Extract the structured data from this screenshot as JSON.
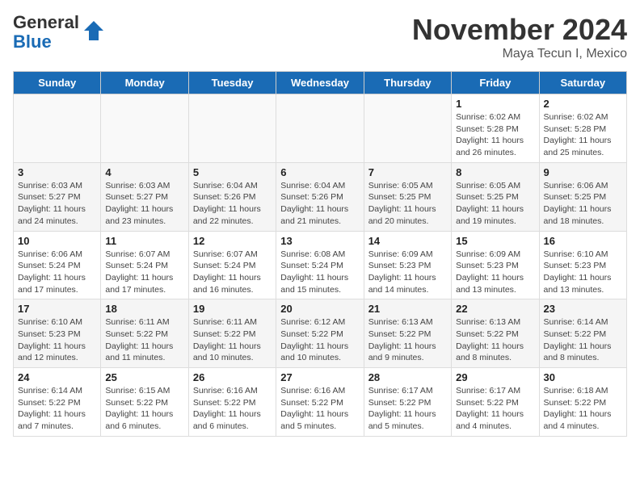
{
  "header": {
    "logo_general": "General",
    "logo_blue": "Blue",
    "month_title": "November 2024",
    "subtitle": "Maya Tecun I, Mexico"
  },
  "days_of_week": [
    "Sunday",
    "Monday",
    "Tuesday",
    "Wednesday",
    "Thursday",
    "Friday",
    "Saturday"
  ],
  "weeks": [
    [
      {
        "day": "",
        "info": ""
      },
      {
        "day": "",
        "info": ""
      },
      {
        "day": "",
        "info": ""
      },
      {
        "day": "",
        "info": ""
      },
      {
        "day": "",
        "info": ""
      },
      {
        "day": "1",
        "info": "Sunrise: 6:02 AM\nSunset: 5:28 PM\nDaylight: 11 hours and 26 minutes."
      },
      {
        "day": "2",
        "info": "Sunrise: 6:02 AM\nSunset: 5:28 PM\nDaylight: 11 hours and 25 minutes."
      }
    ],
    [
      {
        "day": "3",
        "info": "Sunrise: 6:03 AM\nSunset: 5:27 PM\nDaylight: 11 hours and 24 minutes."
      },
      {
        "day": "4",
        "info": "Sunrise: 6:03 AM\nSunset: 5:27 PM\nDaylight: 11 hours and 23 minutes."
      },
      {
        "day": "5",
        "info": "Sunrise: 6:04 AM\nSunset: 5:26 PM\nDaylight: 11 hours and 22 minutes."
      },
      {
        "day": "6",
        "info": "Sunrise: 6:04 AM\nSunset: 5:26 PM\nDaylight: 11 hours and 21 minutes."
      },
      {
        "day": "7",
        "info": "Sunrise: 6:05 AM\nSunset: 5:25 PM\nDaylight: 11 hours and 20 minutes."
      },
      {
        "day": "8",
        "info": "Sunrise: 6:05 AM\nSunset: 5:25 PM\nDaylight: 11 hours and 19 minutes."
      },
      {
        "day": "9",
        "info": "Sunrise: 6:06 AM\nSunset: 5:25 PM\nDaylight: 11 hours and 18 minutes."
      }
    ],
    [
      {
        "day": "10",
        "info": "Sunrise: 6:06 AM\nSunset: 5:24 PM\nDaylight: 11 hours and 17 minutes."
      },
      {
        "day": "11",
        "info": "Sunrise: 6:07 AM\nSunset: 5:24 PM\nDaylight: 11 hours and 17 minutes."
      },
      {
        "day": "12",
        "info": "Sunrise: 6:07 AM\nSunset: 5:24 PM\nDaylight: 11 hours and 16 minutes."
      },
      {
        "day": "13",
        "info": "Sunrise: 6:08 AM\nSunset: 5:24 PM\nDaylight: 11 hours and 15 minutes."
      },
      {
        "day": "14",
        "info": "Sunrise: 6:09 AM\nSunset: 5:23 PM\nDaylight: 11 hours and 14 minutes."
      },
      {
        "day": "15",
        "info": "Sunrise: 6:09 AM\nSunset: 5:23 PM\nDaylight: 11 hours and 13 minutes."
      },
      {
        "day": "16",
        "info": "Sunrise: 6:10 AM\nSunset: 5:23 PM\nDaylight: 11 hours and 13 minutes."
      }
    ],
    [
      {
        "day": "17",
        "info": "Sunrise: 6:10 AM\nSunset: 5:23 PM\nDaylight: 11 hours and 12 minutes."
      },
      {
        "day": "18",
        "info": "Sunrise: 6:11 AM\nSunset: 5:22 PM\nDaylight: 11 hours and 11 minutes."
      },
      {
        "day": "19",
        "info": "Sunrise: 6:11 AM\nSunset: 5:22 PM\nDaylight: 11 hours and 10 minutes."
      },
      {
        "day": "20",
        "info": "Sunrise: 6:12 AM\nSunset: 5:22 PM\nDaylight: 11 hours and 10 minutes."
      },
      {
        "day": "21",
        "info": "Sunrise: 6:13 AM\nSunset: 5:22 PM\nDaylight: 11 hours and 9 minutes."
      },
      {
        "day": "22",
        "info": "Sunrise: 6:13 AM\nSunset: 5:22 PM\nDaylight: 11 hours and 8 minutes."
      },
      {
        "day": "23",
        "info": "Sunrise: 6:14 AM\nSunset: 5:22 PM\nDaylight: 11 hours and 8 minutes."
      }
    ],
    [
      {
        "day": "24",
        "info": "Sunrise: 6:14 AM\nSunset: 5:22 PM\nDaylight: 11 hours and 7 minutes."
      },
      {
        "day": "25",
        "info": "Sunrise: 6:15 AM\nSunset: 5:22 PM\nDaylight: 11 hours and 6 minutes."
      },
      {
        "day": "26",
        "info": "Sunrise: 6:16 AM\nSunset: 5:22 PM\nDaylight: 11 hours and 6 minutes."
      },
      {
        "day": "27",
        "info": "Sunrise: 6:16 AM\nSunset: 5:22 PM\nDaylight: 11 hours and 5 minutes."
      },
      {
        "day": "28",
        "info": "Sunrise: 6:17 AM\nSunset: 5:22 PM\nDaylight: 11 hours and 5 minutes."
      },
      {
        "day": "29",
        "info": "Sunrise: 6:17 AM\nSunset: 5:22 PM\nDaylight: 11 hours and 4 minutes."
      },
      {
        "day": "30",
        "info": "Sunrise: 6:18 AM\nSunset: 5:22 PM\nDaylight: 11 hours and 4 minutes."
      }
    ]
  ]
}
